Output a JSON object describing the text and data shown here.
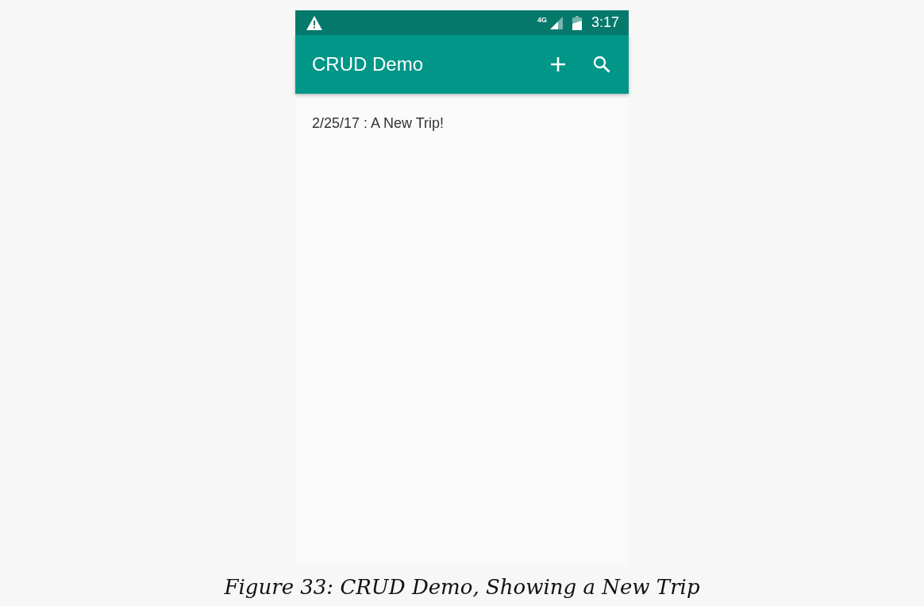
{
  "status_bar": {
    "network": "4G",
    "time": "3:17"
  },
  "app_bar": {
    "title": "CRUD Demo"
  },
  "trips": [
    {
      "label": "2/25/17 : A New Trip!"
    }
  ],
  "caption": "Figure 33: CRUD Demo, Showing a New Trip"
}
